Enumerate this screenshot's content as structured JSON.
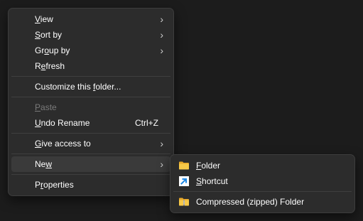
{
  "context_menu": {
    "items": [
      {
        "pre": "",
        "key": "V",
        "post": "iew"
      },
      {
        "pre": "",
        "key": "S",
        "post": "ort by"
      },
      {
        "pre": "Gr",
        "key": "o",
        "post": "up by"
      },
      {
        "pre": "R",
        "key": "e",
        "post": "fresh"
      },
      {
        "pre": "Customize this ",
        "key": "f",
        "post": "older..."
      },
      {
        "pre": "",
        "key": "P",
        "post": "aste"
      },
      {
        "pre": "",
        "key": "U",
        "post": "ndo Rename",
        "shortcut": "Ctrl+Z"
      },
      {
        "pre": "",
        "key": "G",
        "post": "ive access to"
      },
      {
        "pre": "Ne",
        "key": "w",
        "post": ""
      },
      {
        "pre": "P",
        "key": "r",
        "post": "operties"
      }
    ],
    "chevron": "›"
  },
  "new_submenu": {
    "items": [
      {
        "pre": "",
        "key": "F",
        "post": "older",
        "icon": "folder-icon"
      },
      {
        "pre": "",
        "key": "S",
        "post": "hortcut",
        "icon": "shortcut-icon"
      },
      {
        "pre": "Compressed (zipped) Folder",
        "key": "",
        "post": "",
        "icon": "zip-folder-icon"
      }
    ]
  },
  "colors": {
    "menu_bg": "#2c2c2c",
    "hover_bg": "#3a3a3a",
    "disabled_text": "#7a7a7a",
    "folder_yellow": "#f7c948",
    "shortcut_blue": "#1e88e5"
  }
}
